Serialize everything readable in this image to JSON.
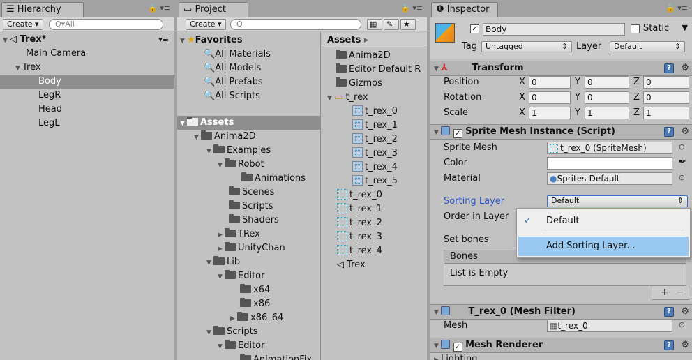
{
  "hierarchy": {
    "tab": "Hierarchy",
    "create": "Create",
    "search_placeholder": "All",
    "scene": "Trex*",
    "items": [
      "Main Camera",
      "Trex",
      "Body",
      "LegR",
      "Head",
      "LegL"
    ]
  },
  "project": {
    "tab": "Project",
    "create": "Create",
    "favorites": {
      "label": "Favorites",
      "items": [
        "All Materials",
        "All Models",
        "All Prefabs",
        "All Scripts"
      ]
    },
    "assets_label": "Assets",
    "tree": [
      "Anima2D",
      "Examples",
      "Robot",
      "Animations",
      "Scenes",
      "Scripts",
      "Shaders",
      "TRex",
      "UnityChan",
      "Lib",
      "Editor",
      "x64",
      "x86",
      "x86_64",
      "Scripts",
      "Editor",
      "AnimationFix"
    ],
    "breadcrumb": "Assets",
    "assets": [
      "Anima2D",
      "Editor Default R",
      "Gizmos",
      "t_rex",
      "t_rex_0",
      "t_rex_1",
      "t_rex_2",
      "t_rex_3",
      "t_rex_4",
      "t_rex_5",
      "t_rex_0",
      "t_rex_1",
      "t_rex_2",
      "t_rex_3",
      "t_rex_4",
      "Trex"
    ]
  },
  "inspector": {
    "tab": "Inspector",
    "name": "Body",
    "static_label": "Static",
    "tag_label": "Tag",
    "tag_value": "Untagged",
    "layer_label": "Layer",
    "layer_value": "Default",
    "transform": {
      "title": "Transform",
      "position_label": "Position",
      "rotation_label": "Rotation",
      "scale_label": "Scale",
      "axis_x": "X",
      "axis_y": "Y",
      "axis_z": "Z",
      "position": [
        "0",
        "0",
        "0"
      ],
      "rotation": [
        "0",
        "0",
        "0"
      ],
      "scale": [
        "1",
        "1",
        "1"
      ]
    },
    "sprite_mesh": {
      "title": "Sprite Mesh Instance (Script)",
      "sprite_mesh_label": "Sprite Mesh",
      "sprite_mesh_value": "t_rex_0 (SpriteMesh)",
      "color_label": "Color",
      "material_label": "Material",
      "material_value": "Sprites-Default",
      "sorting_layer_label": "Sorting Layer",
      "sorting_layer_value": "Default",
      "order_label": "Order in Layer",
      "set_bones_label": "Set bones",
      "bones_header": "Bones",
      "bones_empty": "List is Empty",
      "plus": "+",
      "minus": "−"
    },
    "dropdown": {
      "check": "✓",
      "items": [
        "Default",
        "Add Sorting Layer..."
      ]
    },
    "mesh_filter": {
      "title": "T_rex_0 (Mesh Filter)",
      "mesh_label": "Mesh",
      "mesh_value": "t_rex_0"
    },
    "mesh_renderer": {
      "title": "Mesh Renderer",
      "lighting": "Lighting"
    }
  }
}
